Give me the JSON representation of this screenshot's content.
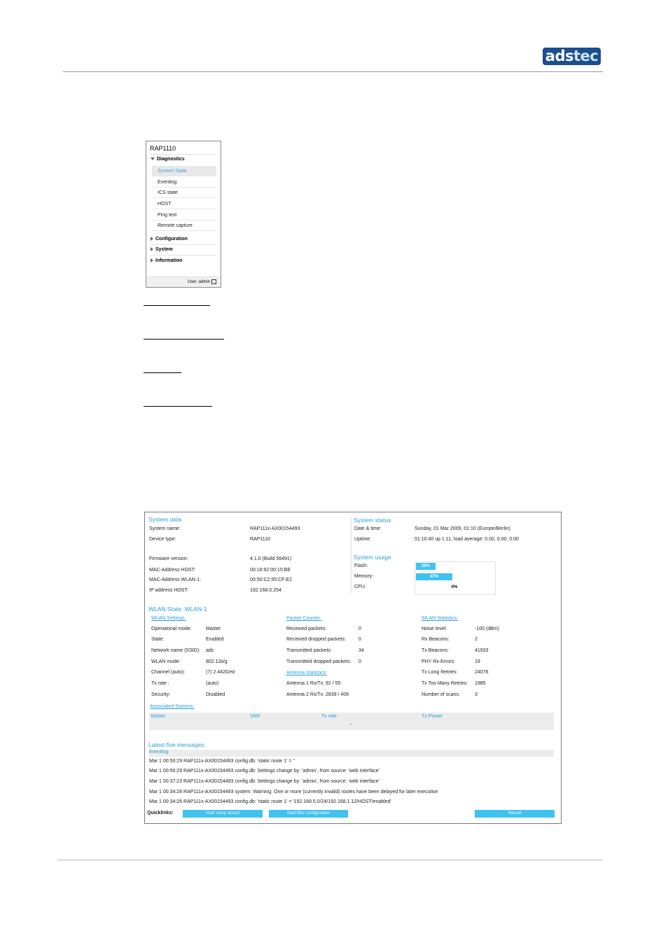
{
  "header": {
    "logo_ads": "ads",
    "logo_tec": "tec"
  },
  "menu": {
    "title": "RAP1110",
    "groups": [
      {
        "label": "Diagnostics",
        "expanded": true
      },
      {
        "label": "Configuration",
        "expanded": false
      },
      {
        "label": "System",
        "expanded": false
      },
      {
        "label": "Information",
        "expanded": false
      }
    ],
    "items": [
      "System State",
      "Eventlog",
      "ICS state",
      "HOST",
      "Ping test",
      "Remote capture"
    ],
    "selected": "System State",
    "user_label": "User: admin"
  },
  "system_data": {
    "title": "System data",
    "rows": [
      {
        "label": "System name:",
        "value": "RAP111x-AX00154493"
      },
      {
        "label": "Device type:",
        "value": "RAP1110"
      },
      {
        "label": "Firmware version:",
        "value": "4.1.0 (Build 56491)"
      },
      {
        "label": "MAC-Address HOST:",
        "value": "00:18:92:00:15:BE"
      },
      {
        "label": "MAC-Address WLAN-1:",
        "value": "00:50:C2:55:CF:E2"
      },
      {
        "label": "IP address HOST:",
        "value": "192.168.0.254"
      }
    ]
  },
  "system_status": {
    "title": "System status",
    "rows": [
      {
        "label": "Date & time:",
        "value": "Sunday, 01 Mar 2009, 01:10 (Europe/Berlin)"
      },
      {
        "label": "Uptime:",
        "value": "01:10:40 up 1:11, load average: 0.00, 0.00, 0.00"
      }
    ]
  },
  "system_usage": {
    "title": "System usage",
    "bars": [
      {
        "label": "Flash:",
        "percent": 25,
        "text": "25%"
      },
      {
        "label": "Memory:",
        "percent": 47,
        "text": "47%"
      },
      {
        "label": "CPU:",
        "percent": 0,
        "text": "0%"
      }
    ],
    "bar_color": "#3ec3f0"
  },
  "wlan": {
    "title": "WLAN State: WLAN-1",
    "settings": {
      "title": "WLAN Settings:",
      "rows": [
        {
          "label": "Operational mode:",
          "value": "Master"
        },
        {
          "label": "State:",
          "value": "Enabled"
        },
        {
          "label": "Network name (SSID):",
          "value": "ads"
        },
        {
          "label": "WLAN mode:",
          "value": "802.11b/g"
        },
        {
          "label": "Channel (auto):",
          "value": "(7) 2.442GHz"
        },
        {
          "label": "Tx rate :",
          "value": "(auto)"
        },
        {
          "label": "Security:",
          "value": "Disabled"
        }
      ]
    },
    "packets": {
      "title": "Packet Counter:",
      "rows": [
        {
          "label": "Received packets:",
          "value": "0"
        },
        {
          "label": "Received dropped packets:",
          "value": "0"
        },
        {
          "label": "Transmitted packets:",
          "value": "34"
        },
        {
          "label": "Transmitted dropped packets:",
          "value": "0"
        }
      ]
    },
    "antenna": {
      "title": "Antenna Statistics:",
      "rows": [
        "Antenna 1 Rx/Tx: 92 / 55",
        "Antenna 2 Rx/Tx: 2839 / 406"
      ]
    },
    "stats": {
      "title": "WLAN Statistics:",
      "rows": [
        {
          "label": "Noise level:",
          "value": "-100 (dBm)"
        },
        {
          "label": "Rx Beacons:",
          "value": "2"
        },
        {
          "label": "Tx Beacons:",
          "value": "41933"
        },
        {
          "label": "PHY Rx-Errors:",
          "value": "19"
        },
        {
          "label": "Tx Long Retries:",
          "value": "24076"
        },
        {
          "label": "Tx Too Many Retries:",
          "value": "1985"
        },
        {
          "label": "Number of scans:",
          "value": "3"
        }
      ]
    },
    "associated": {
      "title": "Associated Stations:",
      "columns": [
        "Station",
        "SNR",
        "Tx rate",
        "Tx Power"
      ],
      "empty": "-"
    }
  },
  "messages": {
    "title": "Latest five messages",
    "subtitle": "Eventlog",
    "lines": [
      "Mar 1 00:50:29 RAP111x-AX00154493 config.db: 'static route 1' = ''",
      "Mar 1 00:50:29 RAP111x-AX00154493 config.db: Settings change by: 'admin', from source: 'web interface'",
      "Mar 1 00:37:23 RAP111x-AX00154493 config.db: Settings change by: 'admin', from source: 'web interface'",
      "Mar 1 00:34:28 RAP111x-AX00154493 system: Warning: One or more (currently invalid) routes have been delayed for later execution",
      "Mar 1 00:34:26 RAP111x-AX00154493 config.db: 'static route 1' = '192.168.5.0/24/192.168.1.12/HOST/enabled'"
    ]
  },
  "quicklinks": {
    "label": "Quicklinks:",
    "setup": "Start setup wizard",
    "filter": "Start filter configuration",
    "reload": "Reload"
  }
}
